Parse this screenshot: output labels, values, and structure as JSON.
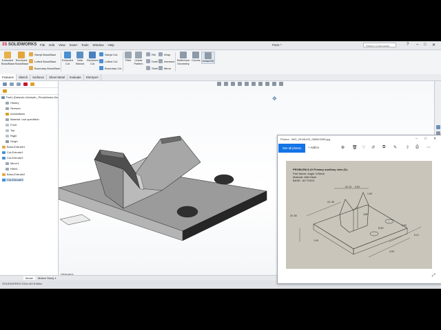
{
  "app": {
    "logo": "SOLIDWORKS",
    "menu": [
      "File",
      "Edit",
      "View",
      "Insert",
      "Tools",
      "Window",
      "Help"
    ],
    "doc_title": "Part1 *",
    "search_placeholder": "Search Commands"
  },
  "ribbon": {
    "big_buttons": [
      {
        "label": "Extruded\nBoss/Base",
        "icon": "extrude-boss-icon"
      },
      {
        "label": "Revolved\nBoss/Base",
        "icon": "revolve-boss-icon"
      },
      {
        "label": "Extruded\nCut",
        "icon": "extrude-cut-icon"
      },
      {
        "label": "Hole\nWizard",
        "icon": "hole-wizard-icon"
      },
      {
        "label": "Revolved\nCut",
        "icon": "revolve-cut-icon"
      },
      {
        "label": "Fillet",
        "icon": "fillet-icon"
      },
      {
        "label": "Linear\nPattern",
        "icon": "linear-pattern-icon"
      },
      {
        "label": "Reference\nGeometry",
        "icon": "reference-geometry-icon"
      },
      {
        "label": "Curves",
        "icon": "curves-icon"
      },
      {
        "label": "Instant3D",
        "icon": "instant3d-icon"
      }
    ],
    "small_boss": [
      "Swept Boss/Base",
      "Lofted Boss/Base",
      "Boundary Boss/Base"
    ],
    "small_cut": [
      "Swept Cut",
      "Lofted Cut",
      "Boundary Cut"
    ],
    "small_feat1": [
      "Rib",
      "Draft",
      "Shell"
    ],
    "small_feat2": [
      "Wrap",
      "Intersect",
      "Mirror"
    ]
  },
  "tabs": [
    "Features",
    "Sketch",
    "Surfaces",
    "Sheet Metal",
    "Evaluate",
    "DimXpert"
  ],
  "tree": {
    "root": "Part1 (Default<<Default>_PhotoWorks Dis",
    "items": [
      "History",
      "Sensors",
      "Annotations",
      "Material <not specified>",
      "Front",
      "Top",
      "Right",
      "Origin",
      "Boss-Extrude1",
      "Cut-Extrude1",
      "Cut-Extrude2",
      "Mirror1",
      "Fillet1",
      "Boss-Extrude2",
      "Cut-Extrude3"
    ]
  },
  "bottom_tabs": [
    "Model",
    "Motion Study 1"
  ],
  "status_text": "SOLIDWORKS 2016 x64 Edition",
  "view_label": "*Trimetric",
  "photos": {
    "title": "Photos - IMG_20181102_084810355.jpg",
    "see_all": "See all photos",
    "add_to": "Add to",
    "image_text": {
      "line1": "PROBLEM 8-22   Primary auxiliary view (5.)",
      "line2": "Part Name: Angle V-Block",
      "line3": "Material: Mild Steel",
      "line4": "BASE: .50 THICK",
      "dims": [
        "2X 10",
        "3.00",
        "1.50",
        "2X .50",
        "135°",
        "R.50",
        "2.00",
        "4.00",
        "5.12",
        "1.00",
        "20 .50"
      ]
    }
  },
  "colors": {
    "accent": "#1473e6",
    "solidworks_red": "#c8102e",
    "model_face": "#9a9a9a",
    "model_dark": "#262626"
  }
}
